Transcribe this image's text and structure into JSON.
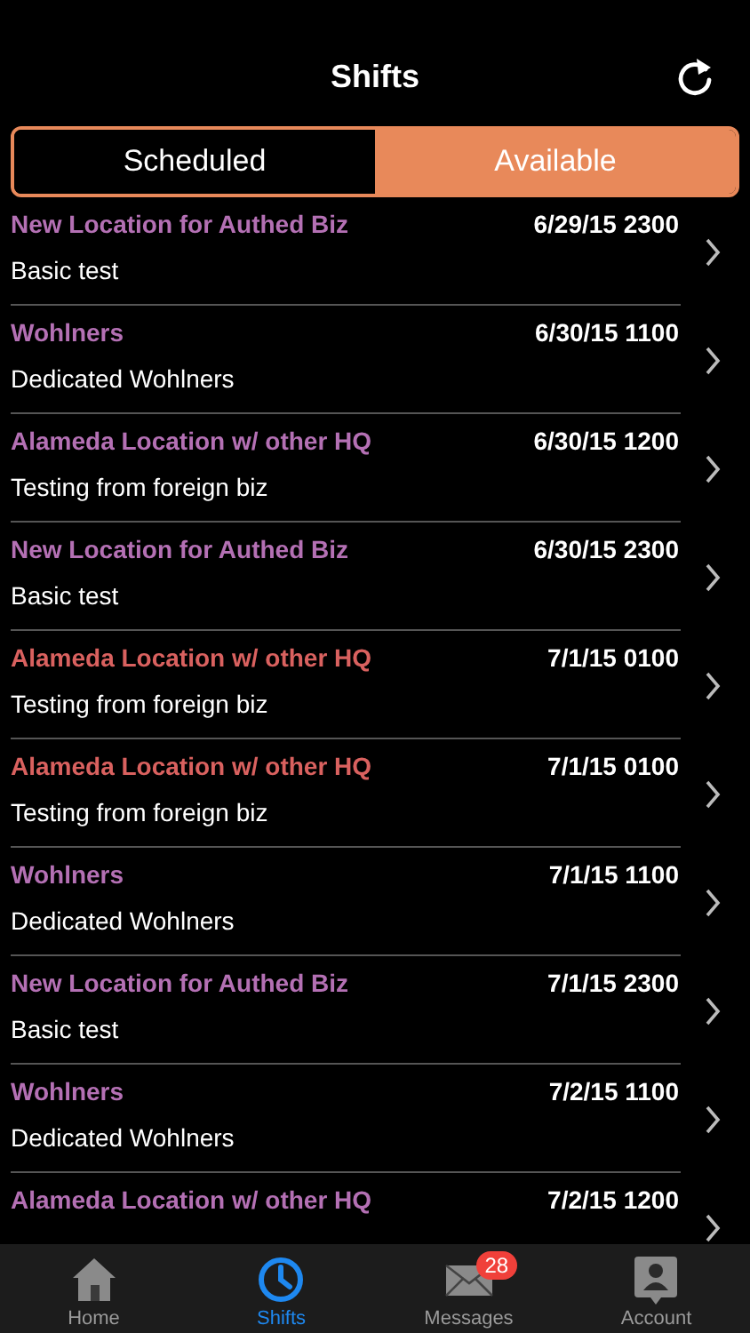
{
  "header": {
    "title": "Shifts"
  },
  "segments": [
    {
      "label": "Scheduled",
      "selected": false
    },
    {
      "label": "Available",
      "selected": true
    }
  ],
  "shifts": [
    {
      "location": "New Location for Authed Biz",
      "color": "#b470b4",
      "date": "6/29/15 2300",
      "description": "Basic test"
    },
    {
      "location": "Wohlners",
      "color": "#b470b4",
      "date": "6/30/15 1100",
      "description": "Dedicated Wohlners"
    },
    {
      "location": "Alameda Location w/ other HQ",
      "color": "#b470b4",
      "date": "6/30/15 1200",
      "description": "Testing from foreign biz"
    },
    {
      "location": "New Location for Authed Biz",
      "color": "#b470b4",
      "date": "6/30/15 2300",
      "description": "Basic test"
    },
    {
      "location": "Alameda Location w/ other HQ",
      "color": "#d9615f",
      "date": "7/1/15 0100",
      "description": "Testing from foreign biz"
    },
    {
      "location": "Alameda Location w/ other HQ",
      "color": "#d9615f",
      "date": "7/1/15 0100",
      "description": "Testing from foreign biz"
    },
    {
      "location": "Wohlners",
      "color": "#b470b4",
      "date": "7/1/15 1100",
      "description": "Dedicated Wohlners"
    },
    {
      "location": "New Location for Authed Biz",
      "color": "#b470b4",
      "date": "7/1/15 2300",
      "description": "Basic test"
    },
    {
      "location": "Wohlners",
      "color": "#b470b4",
      "date": "7/2/15 1100",
      "description": "Dedicated Wohlners"
    },
    {
      "location": "Alameda Location w/ other HQ",
      "color": "#b470b4",
      "date": "7/2/15 1200"
    }
  ],
  "tab_bar": [
    {
      "kind": "home",
      "label": "Home",
      "selected": false
    },
    {
      "kind": "clock",
      "label": "Shifts",
      "selected": true
    },
    {
      "kind": "mail",
      "label": "Messages",
      "selected": false,
      "badge": "28"
    },
    {
      "kind": "account",
      "label": "Account",
      "selected": false
    }
  ]
}
